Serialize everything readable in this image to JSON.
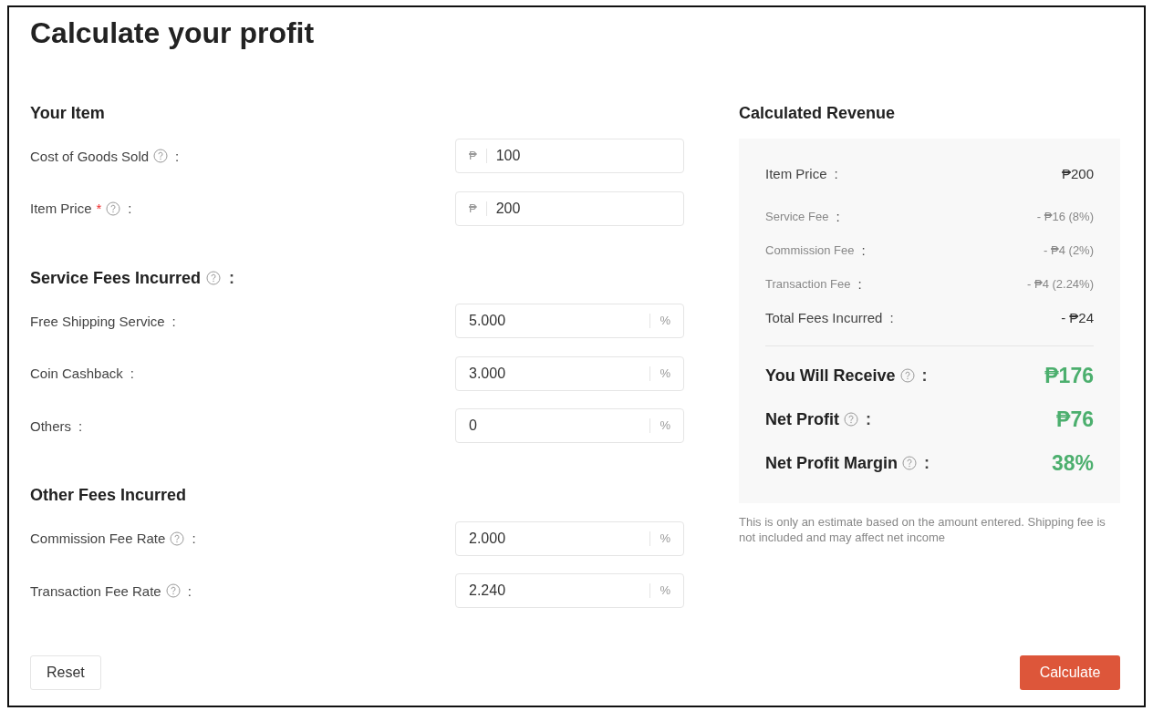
{
  "title": "Calculate your profit",
  "sections": [
    {
      "title": "Your Item",
      "help": false,
      "fields": [
        {
          "label": "Cost of Goods Sold",
          "help": true,
          "colon": ":",
          "prefix": "₱",
          "value": "100"
        },
        {
          "label": "Item Price",
          "required_mark": "*",
          "help": true,
          "colon": ":",
          "prefix": "₱",
          "value": "200"
        }
      ]
    },
    {
      "title": "Service Fees Incurred",
      "help": true,
      "colon": ":",
      "fields": [
        {
          "label": "Free Shipping Service",
          "help": false,
          "colon": ":",
          "value": "5.000",
          "suffix": "%"
        },
        {
          "label": "Coin Cashback",
          "help": false,
          "colon": ":",
          "value": "3.000",
          "suffix": "%"
        },
        {
          "label": "Others",
          "help": false,
          "colon": ":",
          "value": "0",
          "suffix": "%"
        }
      ]
    },
    {
      "title": "Other Fees Incurred",
      "help": false,
      "fields": [
        {
          "label": "Commission Fee Rate",
          "help": true,
          "colon": ":",
          "value": "2.000",
          "suffix": "%"
        },
        {
          "label": "Transaction Fee Rate",
          "help": true,
          "colon": ":",
          "value": "2.240",
          "suffix": "%"
        }
      ]
    }
  ],
  "revenue": {
    "title": "Calculated Revenue",
    "rows": [
      {
        "kind": "main",
        "label": "Item Price",
        "help": false,
        "colon": ":",
        "value": "₱200"
      },
      {
        "kind": "sub",
        "label": "Service Fee",
        "help": false,
        "colon": ":",
        "value": "- ₱16 (8%)"
      },
      {
        "kind": "sub",
        "label": "Commission Fee",
        "help": false,
        "colon": ":",
        "value": "- ₱4 (2%)"
      },
      {
        "kind": "sub",
        "label": "Transaction Fee",
        "help": false,
        "colon": ":",
        "value": "- ₱4 (2.24%)"
      },
      {
        "kind": "total",
        "label": "Total Fees Incurred",
        "help": false,
        "colon": ":",
        "value": "- ₱24"
      },
      {
        "kind": "result",
        "label": "You Will Receive",
        "help": true,
        "colon": ":",
        "value": "₱176"
      },
      {
        "kind": "result",
        "label": "Net Profit",
        "help": true,
        "colon": ":",
        "value": "₱76"
      },
      {
        "kind": "result",
        "label": "Net Profit Margin",
        "help": true,
        "colon": ":",
        "value": "38%"
      }
    ],
    "note": "This is only an estimate based on the amount entered. Shipping fee is not included and may affect net income"
  },
  "buttons": {
    "reset": "Reset",
    "calculate": "Calculate"
  }
}
